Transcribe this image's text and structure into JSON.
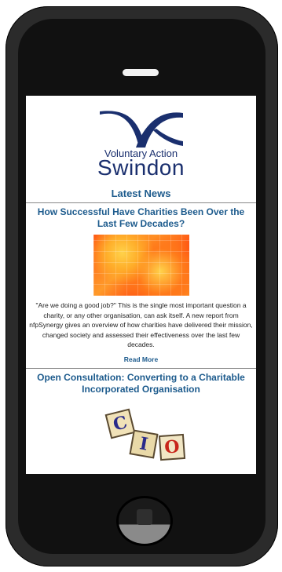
{
  "logo": {
    "line1": "Voluntary Action",
    "line2": "Swindon",
    "brand_color": "#1a2f6e"
  },
  "section": {
    "title": "Latest News"
  },
  "articles": [
    {
      "title": "How Successful Have Charities Been Over the Last Few Decades?",
      "body": "\"Are we doing a good job?\" This is the single most important question a charity, or any other organisation, can ask itself. A new report from nfpSynergy gives an overview of how charities have delivered their mission, changed society and assessed their effectiveness over the last few decades.",
      "read_more": "Read More"
    },
    {
      "title": "Open Consultation: Converting to a Charitable Incorporated Organisation",
      "image_letters": [
        "C",
        "I",
        "O"
      ]
    }
  ],
  "colors": {
    "title": "#1d5b8d",
    "phone_body": "#2b2b2b"
  }
}
